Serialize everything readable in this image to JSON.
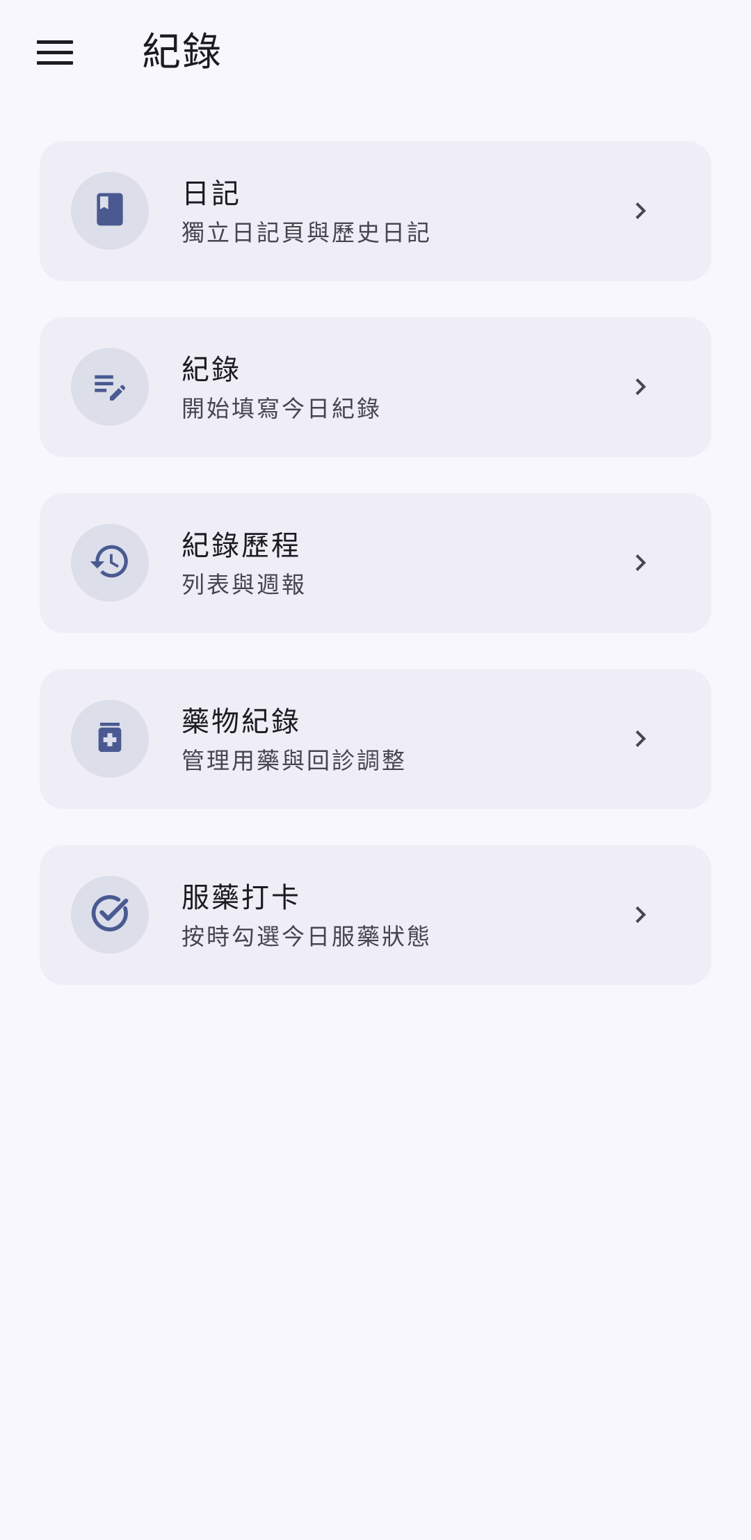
{
  "header": {
    "menu_icon": "menu-icon",
    "title": "紀錄"
  },
  "colors": {
    "background": "#f8f7fd",
    "card": "#efeef6",
    "icon_circle": "#dcdeea",
    "icon": "#4a5a91",
    "text_primary": "#1b1b21",
    "text_secondary": "#46464f"
  },
  "cards": [
    {
      "icon": "bookmark-book-icon",
      "title": "日記",
      "subtitle": "獨立日記頁與歷史日記"
    },
    {
      "icon": "edit-note-icon",
      "title": "紀錄",
      "subtitle": "開始填寫今日紀錄"
    },
    {
      "icon": "history-icon",
      "title": "紀錄歷程",
      "subtitle": "列表與週報"
    },
    {
      "icon": "medication-icon",
      "title": "藥物紀錄",
      "subtitle": "管理用藥與回診調整"
    },
    {
      "icon": "check-circle-icon",
      "title": "服藥打卡",
      "subtitle": "按時勾選今日服藥狀態"
    }
  ]
}
